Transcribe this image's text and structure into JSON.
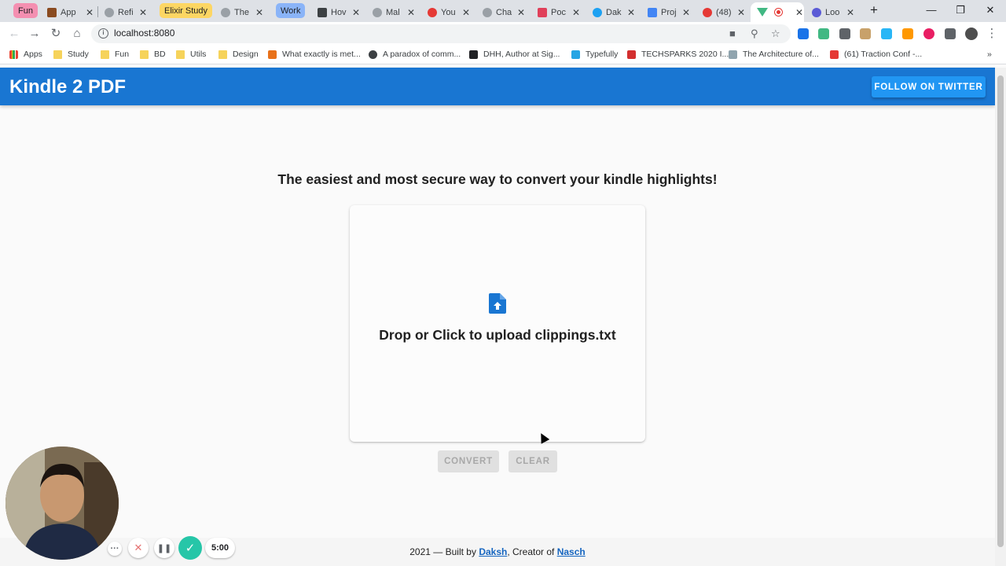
{
  "browser": {
    "tabs": [
      {
        "title": "App",
        "favicon_color": "#8a4b20"
      },
      {
        "title": "Refi",
        "favicon_color": "#5f6368"
      },
      {
        "title": "The",
        "favicon_color": "#5f6368"
      },
      {
        "title": "Hov",
        "favicon_color": "#3c4043"
      },
      {
        "title": "Mal",
        "favicon_color": "#5f6368"
      },
      {
        "title": "You",
        "favicon_color": "#e53935"
      },
      {
        "title": "Cha",
        "favicon_color": "#5f6368"
      },
      {
        "title": "Poc",
        "favicon_color": "#e0405a"
      },
      {
        "title": "Dak",
        "favicon_color": "#1da1f2"
      },
      {
        "title": "Proj",
        "favicon_color": "#4285f4"
      },
      {
        "title": "(48)",
        "favicon_color": "#e53935"
      },
      {
        "title": "",
        "favicon_color": "#41b883"
      },
      {
        "title": "Loo",
        "favicon_color": "#5b5bd6"
      }
    ],
    "tab_groups": [
      {
        "label": "Fun",
        "color": "#f48fb1"
      },
      {
        "label": "Elixir Study",
        "color": "#fdd663"
      },
      {
        "label": "Work",
        "color": "#8ab4f8"
      }
    ],
    "url": "localhost:8080",
    "bookmarks": [
      {
        "label": "Apps",
        "type": "apps"
      },
      {
        "label": "Study",
        "type": "folder"
      },
      {
        "label": "Fun",
        "type": "folder"
      },
      {
        "label": "BD",
        "type": "folder"
      },
      {
        "label": "Utils",
        "type": "folder"
      },
      {
        "label": "Design",
        "type": "folder"
      },
      {
        "label": "What exactly is met...",
        "type": "link"
      },
      {
        "label": "A paradox of comm...",
        "type": "link"
      },
      {
        "label": "DHH, Author at Sig...",
        "type": "link"
      },
      {
        "label": "Typefully",
        "type": "link"
      },
      {
        "label": "TECHSPARKS 2020 I...",
        "type": "link"
      },
      {
        "label": "The Architecture of...",
        "type": "link"
      },
      {
        "label": "(61) Traction Conf -...",
        "type": "link"
      }
    ]
  },
  "app": {
    "title": "Kindle 2 PDF",
    "twitter_label": "FOLLOW ON TWITTER",
    "headline": "The easiest and most secure way to convert your kindle highlights!",
    "dropzone_text": "Drop or Click to upload clippings.txt",
    "convert_label": "CONVERT",
    "clear_label": "CLEAR",
    "footer": {
      "prefix": "2021 — Built by ",
      "author": "Daksh",
      "middle": ", Creator of ",
      "product": "Nasch"
    },
    "colors": {
      "primary": "#1976d2",
      "accent": "#2196f3"
    }
  },
  "recorder": {
    "timer": "5:00"
  }
}
